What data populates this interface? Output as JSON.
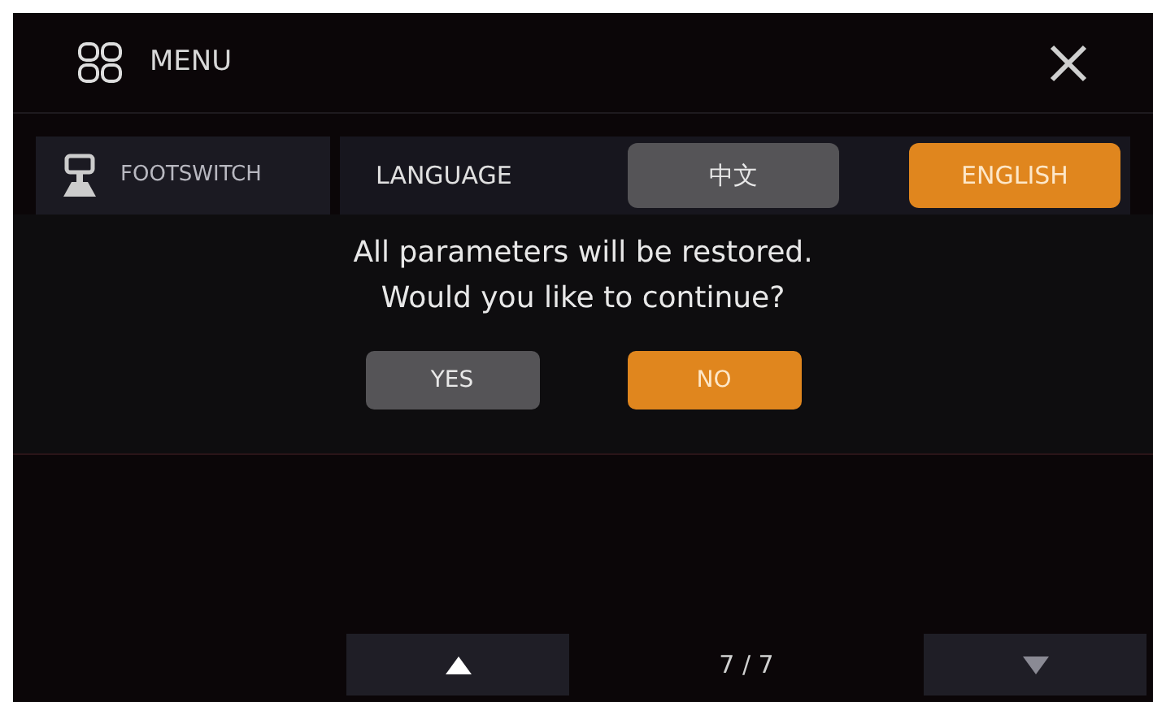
{
  "header": {
    "title": "MENU"
  },
  "sidebar": {
    "items": [
      {
        "label": "FOOTSWITCH",
        "selected": false
      }
    ]
  },
  "language": {
    "label": "LANGUAGE",
    "options": [
      {
        "label": "中文",
        "selected": false
      },
      {
        "label": "ENGLISH",
        "selected": true
      }
    ]
  },
  "dialog": {
    "lines": [
      "All parameters will be restored.",
      "Would you like to continue?"
    ],
    "buttons": [
      {
        "label": "YES",
        "selected": false
      },
      {
        "label": "NO",
        "selected": true
      }
    ]
  },
  "pager": {
    "page": "7 / 7",
    "up_disabled": false,
    "down_disabled": true
  }
}
